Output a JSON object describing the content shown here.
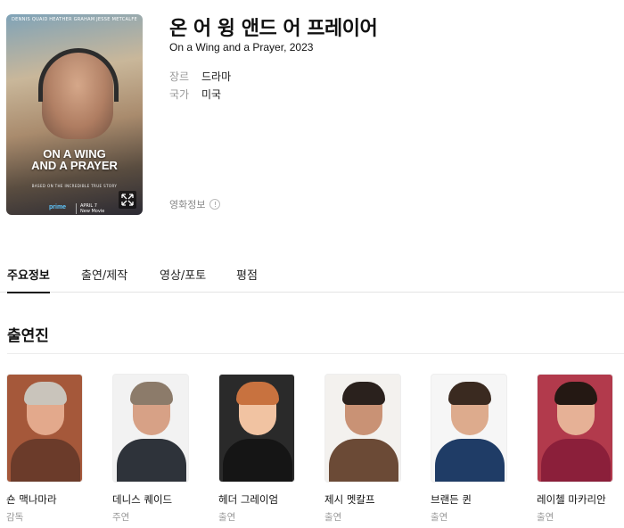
{
  "movie": {
    "title": "온 어 윙 앤드 어 프레이어",
    "subtitle": "On a Wing and a Prayer, 2023",
    "meta": [
      {
        "label": "장르",
        "value": "드라마"
      },
      {
        "label": "국가",
        "value": "미국"
      }
    ],
    "info_link": "영화정보",
    "info_icon": "!"
  },
  "poster": {
    "credits": [
      "DENNIS QUAID",
      "HEATHER GRAHAM",
      "JESSE METCALFE"
    ],
    "title_line1": "ON A WING",
    "title_line2": "AND A PRAYER",
    "tagline": "BASED ON THE INCREDIBLE TRUE STORY",
    "brand": "prime",
    "date_line1": "APRIL 7",
    "date_line2": "New Movie"
  },
  "tabs": [
    {
      "label": "주요정보",
      "active": true
    },
    {
      "label": "출연/제작",
      "active": false
    },
    {
      "label": "영상/포토",
      "active": false
    },
    {
      "label": "평점",
      "active": false
    }
  ],
  "cast_section": {
    "title": "출연진",
    "members": [
      {
        "name": "숀 맥나마라",
        "role": "감독",
        "skin": "#e3a98c",
        "hair": "#c9c4bb",
        "body": "#6b3b2a",
        "bg": "#a5583a"
      },
      {
        "name": "데니스 퀘이드",
        "role": "주연",
        "skin": "#d7a186",
        "hair": "#8c7b6a",
        "body": "#2e333a",
        "bg": "#f2f2f2"
      },
      {
        "name": "헤더 그레이엄",
        "role": "출연",
        "skin": "#f1c3a2",
        "hair": "#c8723f",
        "body": "#151515",
        "bg": "#2a2a2a"
      },
      {
        "name": "제시 멧칼프",
        "role": "출연",
        "skin": "#c99275",
        "hair": "#2a211d",
        "body": "#6b4a36",
        "bg": "#f3f1ee"
      },
      {
        "name": "브랜든 퀸",
        "role": "출연",
        "skin": "#ddab8d",
        "hair": "#3a2a20",
        "body": "#1f3c66",
        "bg": "#f6f6f6"
      },
      {
        "name": "레이첼 마카리안",
        "role": "출연",
        "skin": "#e6b196",
        "hair": "#241813",
        "body": "#8b1f3a",
        "bg": "#b23a4c"
      }
    ]
  }
}
